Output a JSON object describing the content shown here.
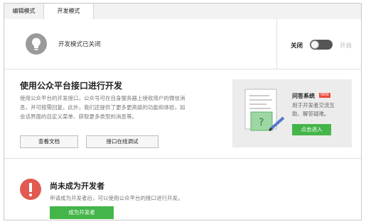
{
  "tabs": [
    "编辑模式",
    "开发模式"
  ],
  "status": {
    "text": "开发模式已关闭",
    "toggle_off_label": "关闭",
    "toggle_on_label": "开启",
    "toggle_state": "off"
  },
  "api": {
    "title": "使用公众平台接口进行开发",
    "desc_line1": "使用公众平台的开发接口，公众号可在自身服务器上接收用户的微信消",
    "desc_line2": "息，并可按需回复。此外，我们还提供了更多更高级的功能和体验，如",
    "desc_line3": "会话界面的自定义菜单、获取更多类型的消息等。",
    "docs_button": "查看文档",
    "debug_button": "接口在线调试"
  },
  "qa": {
    "title": "问答系统",
    "badge": "NEW",
    "desc_line1": "用于开发者交流互",
    "desc_line2": "助、解答疑难。",
    "button": "点击进入"
  },
  "developer": {
    "title": "尚未成为开发者",
    "desc": "申请成为开发者后，可以使用公众平台的接口进行开发。",
    "button": "成为开发者"
  },
  "colors": {
    "green": "#44b549",
    "warning_red": "#e05a4f",
    "toggle_dark": "#555555"
  }
}
